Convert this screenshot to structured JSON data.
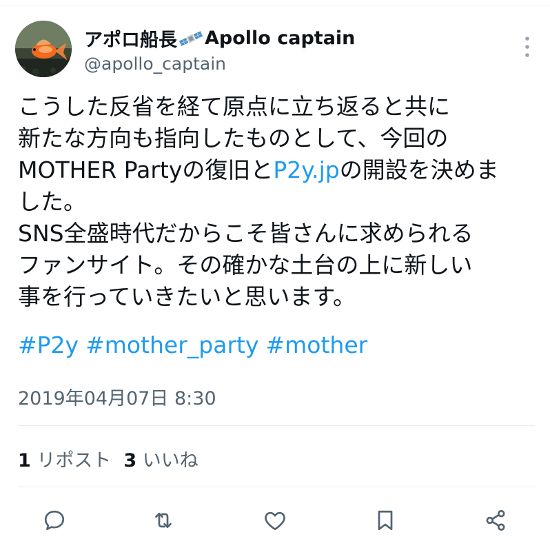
{
  "author": {
    "name": "アポロ船長",
    "name_suffix": "Apollo captain",
    "handle": "@apollo_captain",
    "emoji_icon": "satellite-icon",
    "avatar_icon": "goldfish-avatar"
  },
  "tweet": {
    "lines": [
      [
        {
          "text": "こうした反省を経て原点に立ち返ると共に",
          "link": false
        }
      ],
      [
        {
          "text": "新たな方向も指向したものとして、今回の",
          "link": false
        }
      ],
      [
        {
          "text": "MOTHER Partyの復旧と",
          "link": false
        },
        {
          "text": "P2y.jp",
          "link": true
        },
        {
          "text": "の開設を決めま",
          "link": false
        }
      ],
      [
        {
          "text": "した。",
          "link": false
        }
      ],
      [
        {
          "text": "SNS全盛時代だからこそ皆さんに求められる",
          "link": false
        }
      ],
      [
        {
          "text": "ファンサイト。その確かな土台の上に新しい",
          "link": false
        }
      ],
      [
        {
          "text": "事を行っていきたいと思います。",
          "link": false
        }
      ]
    ],
    "hashtags": [
      "#P2y",
      "#mother_party",
      "#mother"
    ]
  },
  "timestamp": "2019年04月07日 8:30",
  "stats": {
    "reposts_count": "1",
    "reposts_label": "リポスト",
    "likes_count": "3",
    "likes_label": "いいね"
  },
  "actions": [
    {
      "icon": "reply-icon"
    },
    {
      "icon": "repost-icon"
    },
    {
      "icon": "like-icon"
    },
    {
      "icon": "bookmark-icon"
    },
    {
      "icon": "share-icon"
    }
  ],
  "colors": {
    "text": "#0f1419",
    "secondary": "#536471",
    "link": "#1d9bf0",
    "divider": "#e7ebed"
  }
}
